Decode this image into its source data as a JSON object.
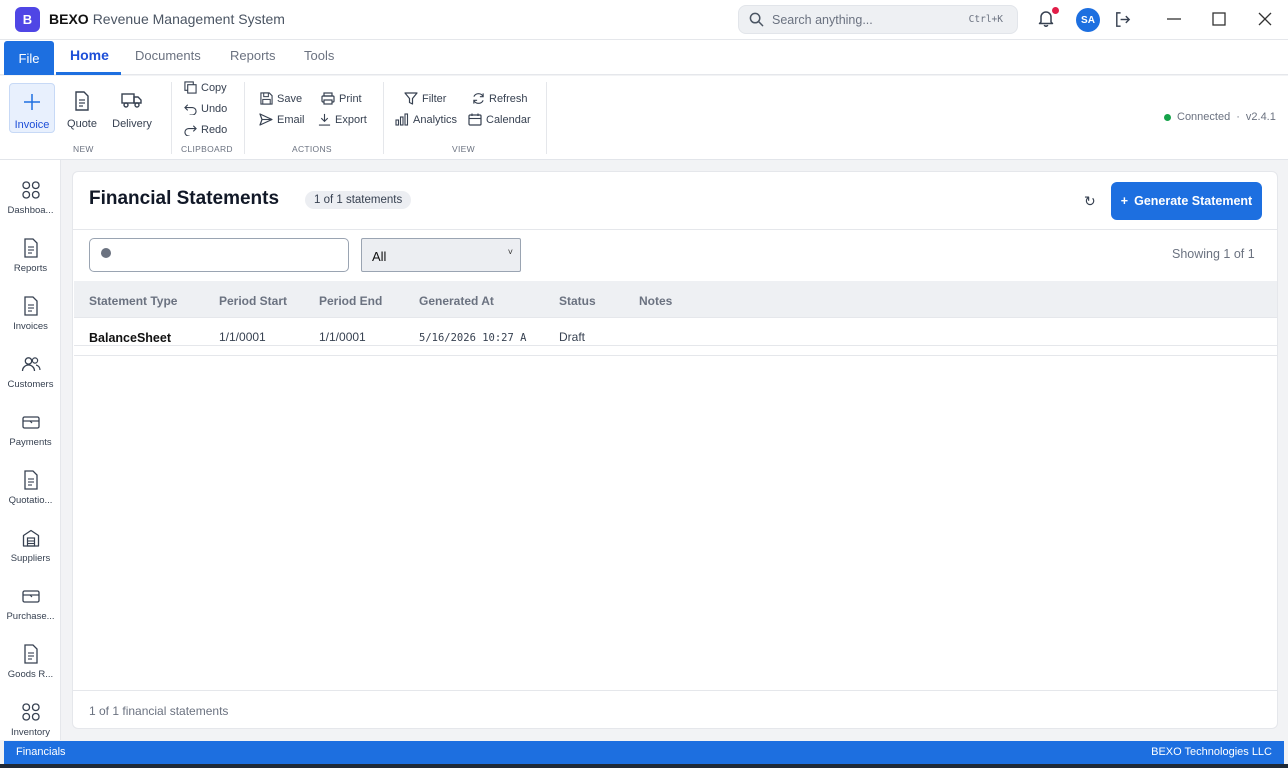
{
  "app": {
    "logo_letter": "B",
    "brand": "BEXO",
    "subtitle": "Revenue Management System"
  },
  "search": {
    "placeholder": "Search anything...",
    "shortcut": "Ctrl+K"
  },
  "user": {
    "initials": "SA"
  },
  "menu": {
    "file": "File",
    "tabs": [
      "Home",
      "Documents",
      "Reports",
      "Tools"
    ],
    "active": "Home"
  },
  "ribbon": {
    "new_group": {
      "label": "NEW",
      "items": [
        "Invoice",
        "Quote",
        "Delivery"
      ]
    },
    "clipboard_group": {
      "label": "CLIPBOARD",
      "items": [
        "Copy",
        "Undo",
        "Redo"
      ]
    },
    "actions_group": {
      "label": "ACTIONS",
      "items": [
        "Save",
        "Print",
        "Email",
        "Export"
      ]
    },
    "view_group": {
      "label": "VIEW",
      "items": [
        "Filter",
        "Refresh",
        "Analytics",
        "Calendar"
      ]
    },
    "connection": {
      "status": "Connected",
      "separator": "·",
      "version": "v2.4.1"
    }
  },
  "sidebar": {
    "items": [
      {
        "label": "Dashboa...",
        "icon": "dashboard-icon"
      },
      {
        "label": "Reports",
        "icon": "document-icon"
      },
      {
        "label": "Invoices",
        "icon": "document-icon"
      },
      {
        "label": "Customers",
        "icon": "users-icon"
      },
      {
        "label": "Payments",
        "icon": "wallet-icon"
      },
      {
        "label": "Quotatio...",
        "icon": "document-icon"
      },
      {
        "label": "Suppliers",
        "icon": "warehouse-icon"
      },
      {
        "label": "Purchase...",
        "icon": "wallet-icon"
      },
      {
        "label": "Goods R...",
        "icon": "document-icon"
      },
      {
        "label": "Inventory",
        "icon": "dashboard-icon"
      }
    ]
  },
  "page": {
    "title": "Financial Statements",
    "badge": "1  of  1  statements",
    "refresh_glyph": "↻",
    "generate_plus": "+",
    "generate_label": "Generate Statement",
    "search_value": "",
    "filter_selected": "All",
    "filter_caret": "˅",
    "showing": "Showing  1  of  1",
    "columns": [
      "Statement Type",
      "Period Start",
      "Period End",
      "Generated At",
      "Status",
      "Notes"
    ],
    "rows": [
      {
        "type": "BalanceSheet",
        "period_start": "1/1/0001",
        "period_end": "1/1/0001",
        "generated_at": "5/16/2026 10:27 A",
        "status": "Draft",
        "notes": ""
      }
    ],
    "footer": "1  of  1  financial statements"
  },
  "statusbar": {
    "left": "Financials",
    "right": "BEXO Technologies LLC"
  },
  "colors": {
    "accent": "#1d6fe0",
    "logo": "#4f46e5",
    "connected": "#16a34a",
    "notification": "#e11d48"
  }
}
